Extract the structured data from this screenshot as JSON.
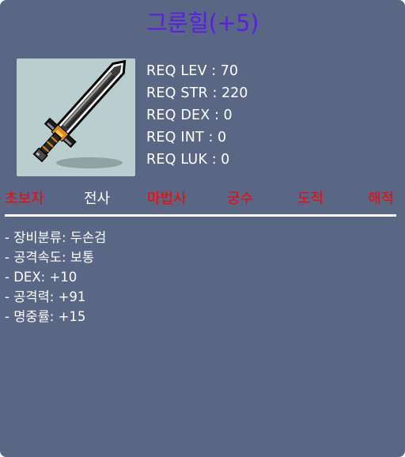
{
  "item": {
    "name": "그룬힐(+5)",
    "icon": "two-handed-sword-icon"
  },
  "requirements": [
    {
      "label": "REQ LEV",
      "value": "70"
    },
    {
      "label": "REQ STR",
      "value": "220"
    },
    {
      "label": "REQ DEX",
      "value": "0"
    },
    {
      "label": "REQ INT",
      "value": "0"
    },
    {
      "label": "REQ LUK",
      "value": "0"
    }
  ],
  "jobs": [
    {
      "label": "초보자",
      "equippable": false
    },
    {
      "label": "전사",
      "equippable": true
    },
    {
      "label": "마법사",
      "equippable": false
    },
    {
      "label": "궁수",
      "equippable": false
    },
    {
      "label": "도적",
      "equippable": false
    },
    {
      "label": "해적",
      "equippable": false
    }
  ],
  "stats": [
    {
      "label": "장비분류",
      "value": "두손검"
    },
    {
      "label": "공격속도",
      "value": "보통"
    },
    {
      "label": "DEX",
      "value": "+10"
    },
    {
      "label": "공격력",
      "value": "+91"
    },
    {
      "label": "명중률",
      "value": "+15"
    }
  ],
  "colors": {
    "panel_bg": "#5a6784",
    "title": "#5b1ee6",
    "job_disabled": "#ff0000",
    "job_enabled": "#ffffff",
    "text": "#ffffff"
  }
}
